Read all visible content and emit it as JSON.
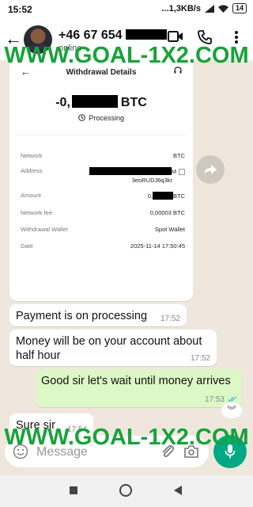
{
  "status_bar": {
    "time": "15:52",
    "network_speed": "...1,3KB/s",
    "battery": "14"
  },
  "header": {
    "contact_phone": "+46 67 654",
    "contact_status": "online"
  },
  "watermark": {
    "text": "WWW.GOAL-1X2.COM",
    "color": "#18a23a"
  },
  "withdrawal_card": {
    "title": "Withdrawal Details",
    "amount_prefix": "-0,",
    "amount_currency": "BTC",
    "status": "Processing",
    "rows": [
      {
        "label": "Network",
        "value": "BTC"
      },
      {
        "label": "Address",
        "value": "M",
        "value2": "3eoRUDJ6q3kr"
      },
      {
        "label": "Amount",
        "value_prefix": "0,",
        "value": "BTC"
      },
      {
        "label": "Network fee",
        "value": "0,00003 BTC"
      },
      {
        "label": "Withdrawal Wallet",
        "value": "Spot Wallet"
      },
      {
        "label": "Date",
        "value": "2025-11-14 17:50:45"
      }
    ]
  },
  "messages": [
    {
      "direction": "in",
      "text": "Payment is on processing",
      "time": "17:52"
    },
    {
      "direction": "in",
      "text": "Money will be on your account about half hour",
      "time": "17:52"
    },
    {
      "direction": "out",
      "text": "Good sir let's wait until money arrives",
      "time": "17:53"
    },
    {
      "direction": "in",
      "text": "Sure sir",
      "time": "17:54"
    }
  ],
  "composer": {
    "placeholder": "Message"
  },
  "colors": {
    "outgoing_bubble": "#dcf8c6",
    "accent": "#00a884",
    "chat_background": "#efe7dd"
  }
}
